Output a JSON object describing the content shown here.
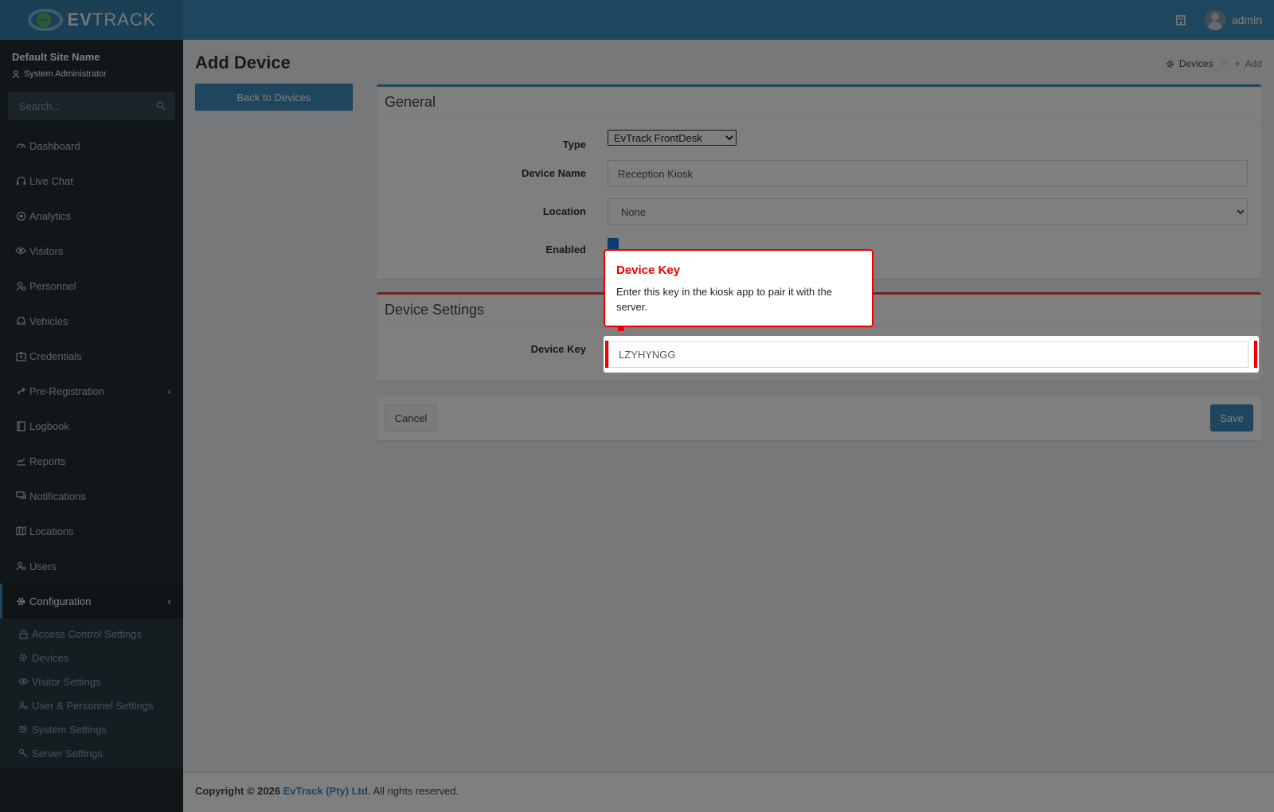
{
  "header": {
    "logo_bold": "EV",
    "logo_light": "TRACK",
    "username": "admin"
  },
  "sidebar": {
    "site_name": "Default Site Name",
    "role": "System Administrator",
    "search_placeholder": "Search...",
    "items": [
      {
        "label": "Dashboard",
        "icon": "dashboard-icon"
      },
      {
        "label": "Live Chat",
        "icon": "headset-icon"
      },
      {
        "label": "Analytics",
        "icon": "target-icon"
      },
      {
        "label": "Visitors",
        "icon": "eye-icon"
      },
      {
        "label": "Personnel",
        "icon": "user-cog-icon"
      },
      {
        "label": "Vehicles",
        "icon": "car-icon"
      },
      {
        "label": "Credentials",
        "icon": "id-badge-icon"
      },
      {
        "label": "Pre-Registration",
        "icon": "arrows-icon"
      },
      {
        "label": "Logbook",
        "icon": "book-icon"
      },
      {
        "label": "Reports",
        "icon": "chart-icon"
      },
      {
        "label": "Notifications",
        "icon": "chat-icon"
      },
      {
        "label": "Locations",
        "icon": "map-icon"
      },
      {
        "label": "Users",
        "icon": "users-icon"
      },
      {
        "label": "Configuration",
        "icon": "gear-icon"
      }
    ],
    "submenu": [
      {
        "label": "Access Control Settings",
        "icon": "lock-icon"
      },
      {
        "label": "Devices",
        "icon": "gear-icon"
      },
      {
        "label": "Visitor Settings",
        "icon": "eye-icon"
      },
      {
        "label": "User & Personnel Settings",
        "icon": "users-icon"
      },
      {
        "label": "System Settings",
        "icon": "sliders-icon"
      },
      {
        "label": "Server Settings",
        "icon": "wrench-icon"
      }
    ]
  },
  "page": {
    "title": "Add Device",
    "breadcrumb_devices": "Devices",
    "breadcrumb_sep": ">",
    "breadcrumb_add": "Add",
    "back_button": "Back to Devices"
  },
  "general": {
    "title": "General",
    "type_label": "Type",
    "type_value": "EvTrack FrontDesk",
    "name_label": "Device Name",
    "name_value": "Reception Kiosk",
    "location_label": "Location",
    "location_value": "None",
    "enabled_label": "Enabled",
    "enabled": true
  },
  "device_settings": {
    "title": "Device Settings",
    "key_label": "Device Key",
    "key_value": "LZYHYNGG"
  },
  "actions": {
    "cancel": "Cancel",
    "save": "Save"
  },
  "tooltip": {
    "title": "Device Key",
    "body": "Enter this key in the kiosk app to pair it with the server."
  },
  "footer": {
    "copyright": "Copyright © 2026",
    "company": "EvTrack (Pty) Ltd.",
    "rights": "All rights reserved."
  },
  "colors": {
    "primary": "#3c8dbc",
    "sidebar_bg": "#222d32",
    "danger": "#dd4b39",
    "tour_highlight": "#ee0000"
  }
}
